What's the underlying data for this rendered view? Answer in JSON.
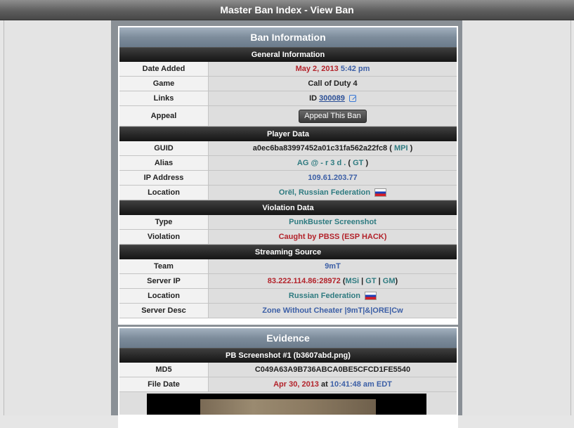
{
  "window": {
    "title": "Master Ban Index - View Ban"
  },
  "ban": {
    "title": "Ban Information",
    "general": {
      "header": "General Information",
      "date_added_label": "Date Added",
      "date": "May 2, 2013",
      "time": "5:42 pm",
      "game_label": "Game",
      "game": "Call of Duty 4",
      "links_label": "Links",
      "id_prefix": "ID",
      "id": "300089",
      "appeal_label": "Appeal",
      "appeal_button": "Appeal This Ban"
    },
    "player": {
      "header": "Player Data",
      "guid_label": "GUID",
      "guid": "a0ec6ba83997452a01c31fa562a22fc8",
      "guid_open": "(",
      "guid_link": "MPI",
      "guid_close": ")",
      "alias_label": "Alias",
      "alias": "AG @ - r 3 d .",
      "alias_open": "(",
      "alias_link": "GT",
      "alias_close": ")",
      "ip_label": "IP Address",
      "ip": "109.61.203.77",
      "location_label": "Location",
      "location": "Orël, Russian Federation"
    },
    "violation": {
      "header": "Violation Data",
      "type_label": "Type",
      "type": "PunkBuster Screenshot",
      "violation_label": "Violation",
      "violation": "Caught by PBSS (ESP HACK)"
    },
    "stream": {
      "header": "Streaming Source",
      "team_label": "Team",
      "team": "9mT",
      "server_ip_label": "Server IP",
      "server_ip": "83.222.114.86:28972",
      "msi": "MSi",
      "gt": "GT",
      "gm": "GM",
      "sep": "|",
      "open": "(",
      "close": ")",
      "location_label": "Location",
      "location": "Russian Federation",
      "desc_label": "Server Desc",
      "desc": "Zone Without Cheater |9mT|&|ORE|Cw"
    }
  },
  "evidence": {
    "title": "Evidence",
    "screenshot_header": "PB Screenshot #1 (b3607abd.png)",
    "md5_label": "MD5",
    "md5": "C049A63A9B736ABCA0BE5CFCD1FE5540",
    "file_date_label": "File Date",
    "file_date": "Apr 30, 2013",
    "at": "at",
    "file_time": "10:41:48 am EDT"
  },
  "colors": {
    "red": "#b3232b",
    "blue": "#3c5fa6",
    "teal": "#2f7b80",
    "header_dark": "#151515",
    "panel_header": "#7d8c9b"
  },
  "icons": [
    "external-link-icon",
    "russia-flag-icon"
  ]
}
